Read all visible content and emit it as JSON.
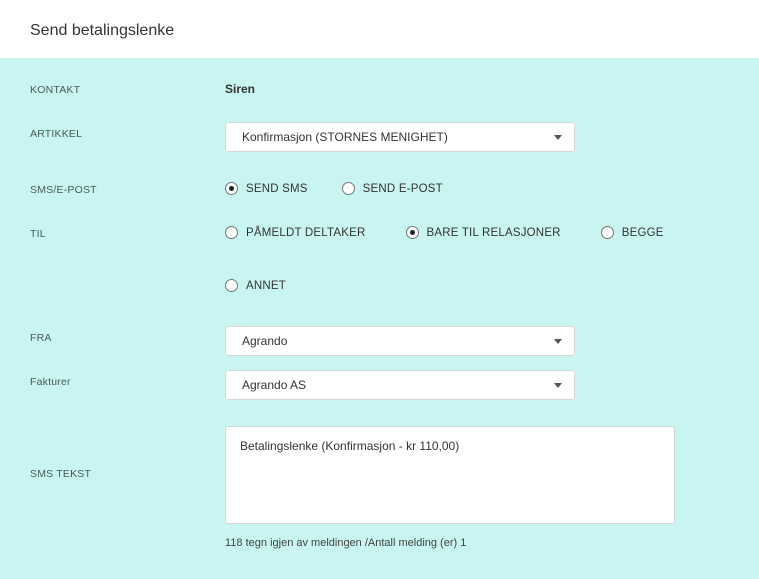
{
  "header": {
    "title": "Send betalingslenke"
  },
  "labels": {
    "kontakt": "KONTAKT",
    "artikkel": "ARTIKKEL",
    "sms_epost": "SMS/E-POST",
    "til": "TIL",
    "fra": "FRA",
    "fakturer": "Fakturer",
    "sms_tekst": "SMS TEKST"
  },
  "kontakt": {
    "value": "Siren"
  },
  "artikkel": {
    "selected": "Konfirmasjon (STORNES MENIGHET)"
  },
  "send_method": {
    "options": [
      {
        "label": "SEND SMS",
        "checked": true
      },
      {
        "label": "SEND E-POST",
        "checked": false
      }
    ]
  },
  "til": {
    "options": [
      {
        "label": "PÅMELDT DELTAKER",
        "checked": false
      },
      {
        "label": "BARE TIL RELASJONER",
        "checked": true
      },
      {
        "label": "BEGGE",
        "checked": false
      },
      {
        "label": "ANNET",
        "checked": false
      }
    ]
  },
  "fra": {
    "selected": "Agrando"
  },
  "fakturer": {
    "selected": "Agrando AS"
  },
  "sms_tekst": {
    "value": "Betalingslenke (Konfirmasjon - kr 110,00)"
  },
  "counter": {
    "chars_left": "118",
    "text_mid": " tegn igjen av meldingen  /Antall melding (er)  ",
    "count": "1"
  }
}
